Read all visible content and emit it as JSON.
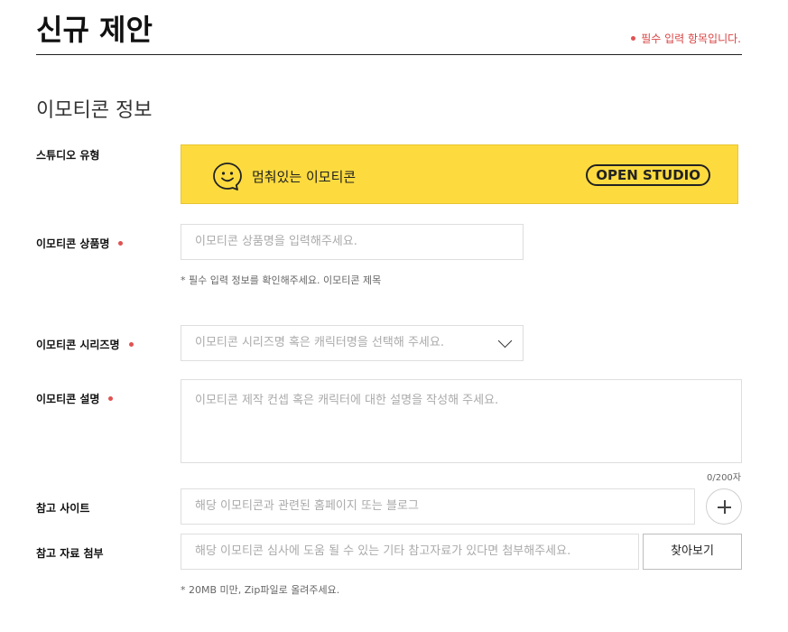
{
  "header": {
    "title": "신규 제안",
    "required_note": "필수 입력 항목입니다."
  },
  "section": {
    "title": "이모티콘 정보"
  },
  "studio_type": {
    "label": "스튜디오 유형",
    "option_name": "멈춰있는 이모티콘",
    "badge": "OPEN STUDIO"
  },
  "product_name": {
    "label": "이모티콘 상품명",
    "placeholder": "이모티콘 상품명을 입력해주세요.",
    "hint": "* 필수 입력 정보를 확인해주세요. 이모티콘 제목"
  },
  "series_name": {
    "label": "이모티콘 시리즈명",
    "placeholder": "이모티콘 시리즈명 혹은 캐릭터명을 선택해 주세요."
  },
  "description": {
    "label": "이모티콘 설명",
    "placeholder": "이모티콘 제작 컨셉 혹은 캐릭터에 대한 설명을 작성해 주세요.",
    "counter": "0/200자"
  },
  "reference_site": {
    "label": "참고 사이트",
    "placeholder": "해당 이모티콘과 관련된 홈페이지 또는 블로그"
  },
  "reference_file": {
    "label": "참고 자료 첨부",
    "placeholder": "해당 이모티콘 심사에 도움 될 수 있는 기타 참고자료가 있다면 첨부해주세요.",
    "button": "찾아보기",
    "hint": "* 20MB 미만, Zip파일로 올려주세요."
  },
  "colors": {
    "accent_yellow": "#fddb3f",
    "required_red": "#e05252"
  }
}
